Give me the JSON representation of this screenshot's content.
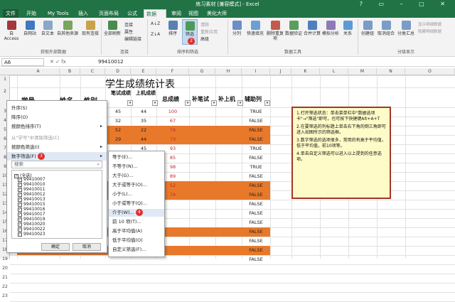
{
  "window": {
    "title": "练习素材 [兼容模式] - Excel",
    "controls": "? ▭ – ▢ ✕"
  },
  "tabs": [
    {
      "label": "文件"
    },
    {
      "label": "开始"
    },
    {
      "label": "My Tools"
    },
    {
      "label": "插入"
    },
    {
      "label": "页面布局"
    },
    {
      "label": "公式"
    },
    {
      "label": "数据"
    },
    {
      "label": "审阅"
    },
    {
      "label": "视图"
    },
    {
      "label": "美化大师"
    }
  ],
  "steps": {
    "one": "1",
    "two": "2",
    "three": "3",
    "four": "4"
  },
  "ribbon": {
    "external": {
      "access": "自 Access",
      "web": "自网站",
      "text": "自文本",
      "other": "自其他来源",
      "existing": "现有连接",
      "group": "获取外部数据"
    },
    "connections": {
      "refresh": "全部刷新",
      "conn": "连接",
      "props": "属性",
      "edit": "编辑链接",
      "group": "连接"
    },
    "sort": {
      "sortasc": "A↓Z",
      "sortdesc": "Z↓A",
      "sort": "排序",
      "filter": "筛选",
      "clear": "清除",
      "reapply": "重新应用",
      "advanced": "高级",
      "group": "排序和筛选"
    },
    "tools": {
      "split": "分列",
      "flash": "快速填充",
      "remove": "删除重复项",
      "validate": "数据验证",
      "consolidate": "合并计算",
      "whatif": "模拟分析",
      "relations": "关系",
      "group": "数据工具"
    },
    "outline": {
      "create": "创建组",
      "ungroup": "取消组合",
      "subtotal": "分类汇总",
      "show": "显示明细数据",
      "hide": "隐藏明细数据",
      "group": "分级显示"
    }
  },
  "formula_bar": {
    "name": "A6",
    "fx": "✕ ✓ fx",
    "value": "99410012"
  },
  "columns": [
    "A",
    "B",
    "C",
    "D",
    "E",
    "F",
    "G",
    "H",
    "I",
    "J",
    "K",
    "L",
    "M",
    "N",
    "O"
  ],
  "rows": [
    "1",
    "2",
    "3",
    "4",
    "5",
    "6",
    "7",
    "8",
    "9",
    "10",
    "11",
    "12",
    "13",
    "14",
    "15",
    "16",
    "17",
    "18",
    "19",
    "20",
    "21",
    "22",
    "23"
  ],
  "sheet": {
    "title": "学生成绩统计表",
    "headers": {
      "id": "学号",
      "name": "姓名",
      "gender": "性别",
      "written": "笔试成绩",
      "machine": "上机成绩",
      "total": "总成绩",
      "bubi": "补笔试",
      "bushang": "补上机",
      "helper": "辅助列"
    },
    "rows": [
      {
        "written": "45",
        "machine": "44",
        "total": "100",
        "helper": "TRUE",
        "orange": false
      },
      {
        "written": "32",
        "machine": "35",
        "total": "67",
        "helper": "FALSE",
        "orange": false
      },
      {
        "written": "52",
        "machine": "22",
        "total": "74",
        "helper": "FALSE",
        "orange": true
      },
      {
        "written": "29",
        "machine": "44",
        "total": "73",
        "helper": "FALSE",
        "orange": true
      },
      {
        "written": "",
        "machine": "45",
        "total": "93",
        "helper": "TRUE",
        "orange": false
      },
      {
        "written": "",
        "machine": "",
        "total": "85",
        "helper": "FALSE",
        "orange": false
      },
      {
        "written": "",
        "machine": "",
        "total": "98",
        "helper": "TRUE",
        "orange": false
      },
      {
        "written": "",
        "machine": "",
        "total": "89",
        "helper": "FALSE",
        "orange": false
      },
      {
        "written": "",
        "machine": "",
        "total": "52",
        "helper": "FALSE",
        "orange": true
      },
      {
        "written": "",
        "machine": "",
        "total": "74",
        "helper": "FALSE",
        "orange": true
      },
      {
        "written": "",
        "machine": "",
        "total": "",
        "helper": "FALSE",
        "orange": false
      },
      {
        "written": "",
        "machine": "",
        "total": "",
        "helper": "FALSE",
        "orange": false
      },
      {
        "written": "",
        "machine": "",
        "total": "",
        "helper": "FALSE",
        "orange": false
      },
      {
        "written": "",
        "machine": "",
        "total": "",
        "helper": "FALSE",
        "orange": true
      },
      {
        "written": "",
        "machine": "",
        "total": "",
        "helper": "FALSE",
        "orange": false
      },
      {
        "written": "",
        "machine": "",
        "total": "",
        "helper": "FALSE",
        "orange": true
      },
      {
        "written": "",
        "machine": "",
        "total": "",
        "helper": "FALSE",
        "orange": false
      },
      {
        "written": "",
        "machine": "",
        "total": "",
        "helper": "FALSE",
        "orange": false
      }
    ]
  },
  "filter_menu": {
    "items": [
      "升序(S)",
      "降序(O)",
      "按颜色排序(T)",
      "从\"学号\"中清除筛选(C)",
      "按颜色筛选(I)",
      "数字筛选(F)"
    ],
    "search_placeholder": "搜索",
    "list": [
      "(全选)",
      "99410007",
      "99410010",
      "99410011",
      "99410012",
      "99410013",
      "99410015",
      "99410016",
      "99410017",
      "99410019",
      "99410020",
      "99410022",
      "99410023"
    ],
    "ok": "确定",
    "cancel": "取消"
  },
  "number_filter_menu": {
    "items": [
      "等于(E)...",
      "不等于(N)...",
      "大于(G)...",
      "大于或等于(O)...",
      "小于(L)...",
      "小于或等于(Q)...",
      "介于(W)...",
      "前 10 项(T)...",
      "高于平均值(A)",
      "低于平均值(O)",
      "自定义筛选(F)..."
    ]
  },
  "note": {
    "p1": "1.打开筛选状态：单击菜单栏中\"数据选项卡\"→\"筛选\"即可，也可按下快捷键Alt+A+T",
    "p2": "2.在要筛选的列标题上单击右下角的倒三角即可进入如图所示的筛选框。",
    "p3": "3.数字筛选的选项很多，常用的有高于平均值，低于平均值，前10项等。",
    "p4": "4.单击自定义筛选可以进入以上提到的任意选项。"
  },
  "colors": {
    "excel_green": "#217346",
    "orange": "#e8792a",
    "note_border": "#a33626",
    "note_bg": "#fffbc8",
    "badge": "#e0312a"
  }
}
